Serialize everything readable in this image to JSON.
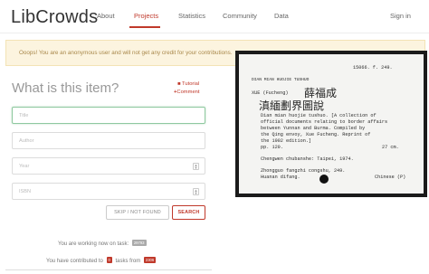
{
  "nav": {
    "logo": "LibCrowds",
    "links": [
      "About",
      "Projects",
      "Statistics",
      "Community",
      "Data"
    ],
    "signin": "Sign in"
  },
  "alert": {
    "text": "Ooops! You are an anonymous user and will not get any credit for your contributions."
  },
  "form": {
    "heading": "What is this item?",
    "tutorial": "Tutorial",
    "comment": "Comment",
    "fields": {
      "title": "Title",
      "author": "Author",
      "year": "Year",
      "isbn": "ISBN"
    },
    "skip_label": "SKIP / NOT FOUND",
    "search_label": "SEARCH"
  },
  "status": {
    "working_prefix": "You are working now on task:",
    "task_id": "29793",
    "contrib_prefix": "You have contributed to",
    "contrib_count": "0",
    "contrib_middle": "tasks from",
    "total_tasks": "2306"
  },
  "document": {
    "catalog_no": "15066. f. 249.",
    "romanized_title": "DIAN MIAN HUOJIE TUSHUO",
    "author_roman": "XUE (Fucheng)",
    "author_cjk": "薛福成",
    "title_cjk": "滇緬劃界圖說",
    "lines": [
      "Dian mian huojie tushuo. [A collection of",
      "official documents relating to border affairs",
      "between Yunnan and Burma. Compiled by",
      "the Qing envoy, Xue Fucheng. Reprint of",
      "the 1902 edition.]"
    ],
    "pages": "pp. 120.",
    "size": "27 cm.",
    "publisher": "Chengwen chubanshe: Taipei, 1974.",
    "series": "Zhongguo fangzhi congshu, 249.",
    "series2": "Huanan difang.",
    "lang": "Chinese (P)"
  },
  "colors": {
    "accent": "#c0392b",
    "alert_bg": "#fcf4df",
    "alert_text": "#a8874a"
  }
}
